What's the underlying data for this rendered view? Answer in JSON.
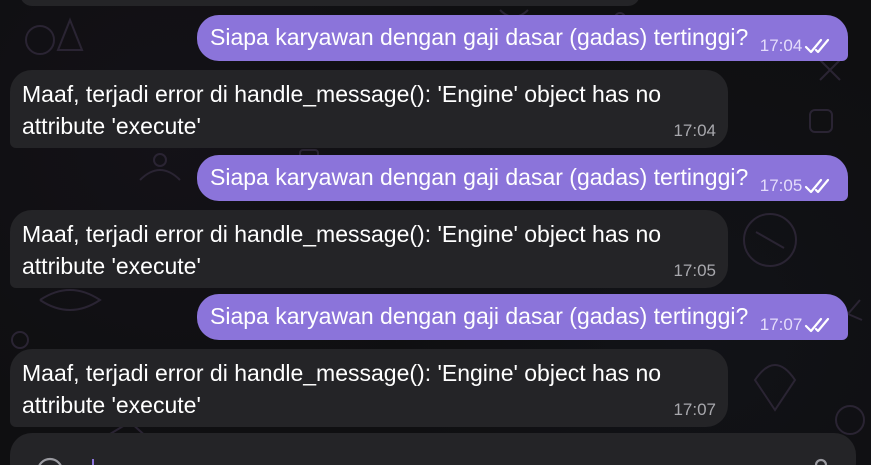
{
  "colors": {
    "outgoing_bubble": "#8b74da",
    "incoming_bubble": "#242427",
    "background": "#0f0f11",
    "text": "#ffffff"
  },
  "messages": [
    {
      "direction": "outgoing",
      "text": "Siapa karyawan dengan gaji dasar (gadas) tertinggi?",
      "time": "17:04",
      "status_icon": "double-check-icon"
    },
    {
      "direction": "incoming",
      "line1": "Maaf, terjadi error di handle_message(): 'Engine' object has no",
      "line2": "attribute 'execute'",
      "time": "17:04"
    },
    {
      "direction": "outgoing",
      "text": "Siapa karyawan dengan gaji dasar (gadas) tertinggi?",
      "time": "17:05",
      "status_icon": "double-check-icon"
    },
    {
      "direction": "incoming",
      "line1": "Maaf, terjadi error di handle_message(): 'Engine' object has no",
      "line2": "attribute 'execute'",
      "time": "17:05"
    },
    {
      "direction": "outgoing",
      "text": "Siapa karyawan dengan gaji dasar (gadas) tertinggi?",
      "time": "17:07",
      "status_icon": "double-check-icon"
    },
    {
      "direction": "incoming",
      "line1": "Maaf, terjadi error di handle_message(): 'Engine' object has no",
      "line2": "attribute 'execute'",
      "time": "17:07"
    }
  ],
  "composer": {
    "icons": [
      "emoji-icon",
      "attach-icon"
    ]
  }
}
